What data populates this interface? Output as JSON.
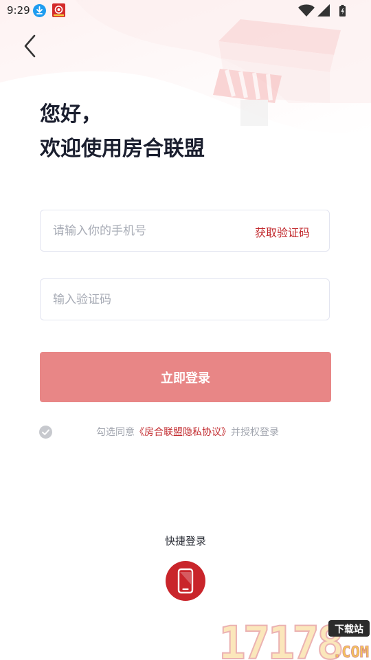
{
  "status_bar": {
    "time": "9:29"
  },
  "greeting": {
    "line1": "您好，",
    "line2": "欢迎使用房合联盟"
  },
  "phone_field": {
    "placeholder": "请输入你的手机号",
    "value": "",
    "get_code_label": "获取验证码"
  },
  "code_field": {
    "placeholder": "输入验证码",
    "value": ""
  },
  "login_button": {
    "label": "立即登录"
  },
  "agreement": {
    "prefix": "勾选同意",
    "link": "《房合联盟隐私协议》",
    "suffix": "并授权登录",
    "checked": false
  },
  "quick_login": {
    "label": "快捷登录",
    "icon": "phone-icon"
  },
  "watermark": {
    "number": "17178",
    "tag": "下载站",
    "domain": ".COM"
  },
  "colors": {
    "accent": "#c22a2e",
    "button": "#e88686",
    "quick_button": "#c9252b",
    "title": "#1a1e2e"
  }
}
